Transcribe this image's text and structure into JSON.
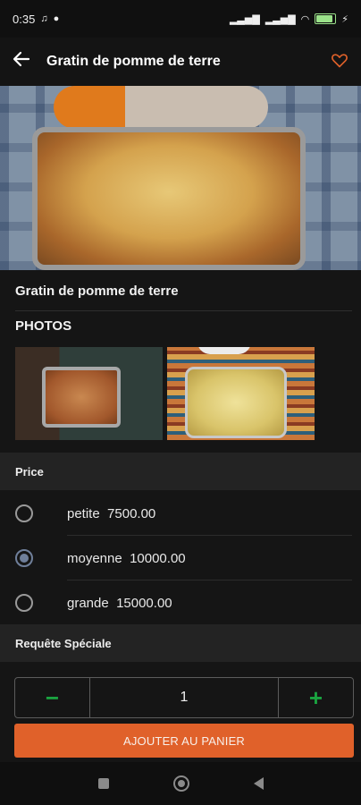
{
  "status_bar": {
    "time": "0:35",
    "network": "4G",
    "battery_level": 0.9
  },
  "app_bar": {
    "title": "Gratin de pomme de terre",
    "back_icon": "arrow-left-icon",
    "favorite_icon": "heart-outline-icon",
    "favorite_color": "#e0612a"
  },
  "dish": {
    "name": "Gratin de pomme de terre"
  },
  "photos": {
    "title": "PHOTOS"
  },
  "price_section": {
    "title": "Price",
    "options": [
      {
        "size": "petite",
        "price": "7500.00",
        "selected": false
      },
      {
        "size": "moyenne",
        "price": "10000.00",
        "selected": true
      },
      {
        "size": "grande",
        "price": "15000.00",
        "selected": false
      }
    ]
  },
  "special_request": {
    "title": "Requête Spéciale"
  },
  "quantity": {
    "decrement_label": "−",
    "value": "1",
    "increment_label": "+"
  },
  "cart": {
    "add_label": "AJOUTER AU PANIER",
    "button_color": "#e0612a"
  }
}
